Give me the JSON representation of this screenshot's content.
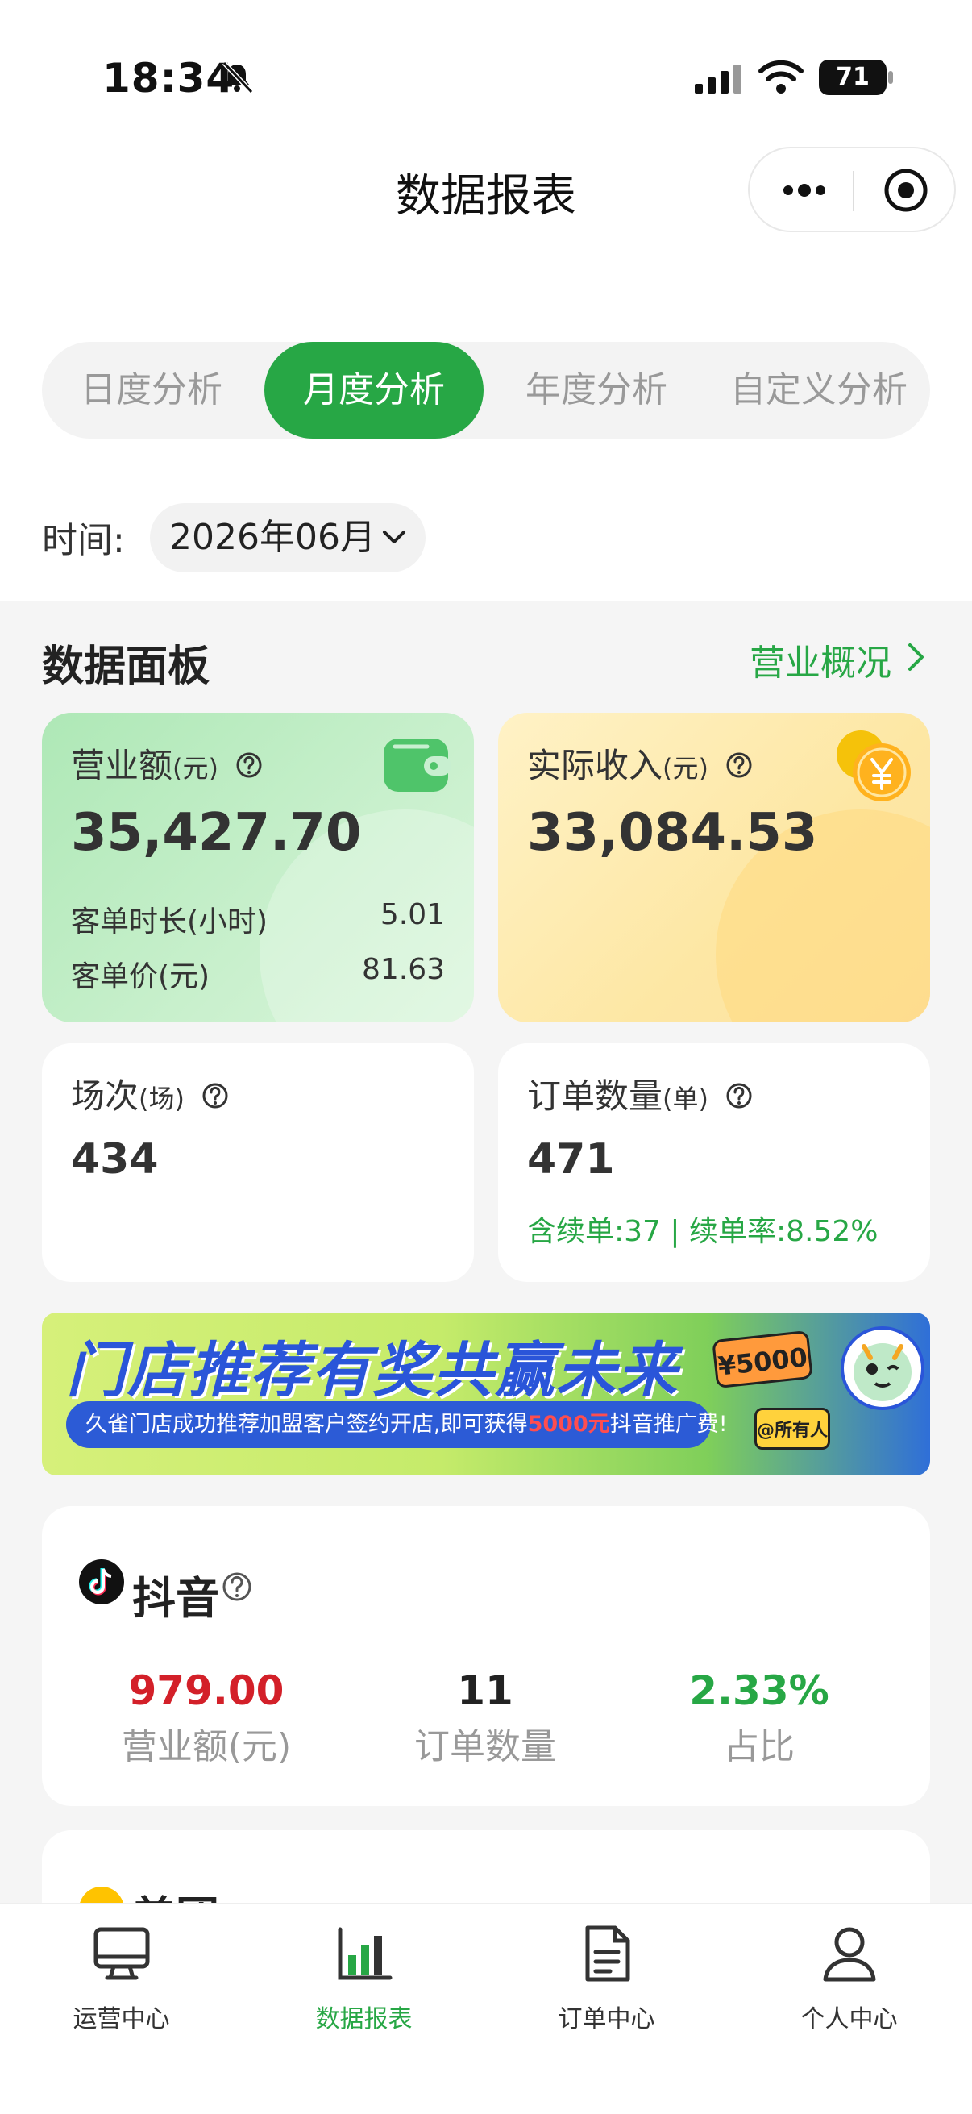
{
  "status_bar": {
    "time": "18:34",
    "battery": "71"
  },
  "nav": {
    "title": "数据报表"
  },
  "tabs": [
    {
      "label": "日度分析",
      "active": false
    },
    {
      "label": "月度分析",
      "active": true
    },
    {
      "label": "年度分析",
      "active": false
    },
    {
      "label": "自定义分析",
      "active": false
    }
  ],
  "time_filter": {
    "label": "时间:",
    "value": "2026年06月"
  },
  "panel": {
    "title": "数据面板",
    "link": "营业概况"
  },
  "cards": {
    "revenue": {
      "label": "营业额",
      "unit": "(元)",
      "value": "35,427.70",
      "rows": [
        {
          "label": "客单时长(小时)",
          "value": "5.01"
        },
        {
          "label": "客单价(元)",
          "value": "81.63"
        }
      ]
    },
    "income": {
      "label": "实际收入",
      "unit": "(元)",
      "value": "33,084.53"
    },
    "sessions": {
      "label": "场次",
      "unit": "(场)",
      "value": "434"
    },
    "orders": {
      "label": "订单数量",
      "unit": "(单)",
      "value": "471",
      "sub": "含续单:37 | 续单率:8.52%"
    }
  },
  "banner": {
    "title": "门店推荐有奖共赢未来",
    "sub_prefix": "久雀门店成功推荐加盟客户签约开店,即可获得",
    "sub_highlight": "5000元",
    "sub_suffix": "抖音推广费!",
    "price_tag": "¥5000",
    "mention_tag": "@所有人"
  },
  "douyin": {
    "name": "抖音",
    "metrics": [
      {
        "value": "979.00",
        "label": "营业额(元)"
      },
      {
        "value": "11",
        "label": "订单数量"
      },
      {
        "value": "2.33%",
        "label": "占比"
      }
    ]
  },
  "meituan": {
    "name": "美团"
  },
  "bottom_nav": [
    {
      "label": "运营中心",
      "active": false
    },
    {
      "label": "数据报表",
      "active": true
    },
    {
      "label": "订单中心",
      "active": false
    },
    {
      "label": "个人中心",
      "active": false
    }
  ],
  "colors": {
    "primary_green": "#27a745",
    "revenue_red": "#d32029"
  }
}
